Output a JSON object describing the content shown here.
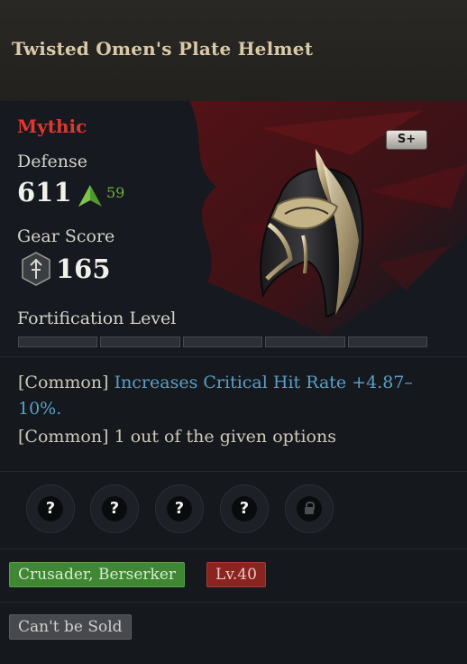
{
  "item": {
    "name": "Twisted Omen's Plate Helmet",
    "rarity": "Mythic",
    "grade_badge": "S+",
    "defense_label": "Defense",
    "defense_value": "611",
    "defense_diff": "59",
    "gear_score_label": "Gear Score",
    "gear_score_value": "165",
    "fortification_label": "Fortification Level",
    "fortification_filled": 0,
    "fortification_total": 5
  },
  "options": [
    {
      "tag": "[Common]",
      "effect": "Increases Critical Hit Rate +4.87–10%."
    },
    {
      "tag": "[Common]",
      "text": "1 out of the given options"
    }
  ],
  "gem_slots": [
    {
      "glyph": "?",
      "locked": false
    },
    {
      "glyph": "?",
      "locked": false
    },
    {
      "glyph": "?",
      "locked": false
    },
    {
      "glyph": "?",
      "locked": false
    },
    {
      "glyph": "",
      "locked": true
    }
  ],
  "tags": {
    "classes": "Crusader, Berserker",
    "level": "Lv.40",
    "sell_status": "Can't be Sold"
  },
  "colors": {
    "rarity": "#e0382f",
    "effect": "#5a9fc8",
    "upgrade": "#6fb13e",
    "class_tag": "#3f8732",
    "level_tag": "#8a2421"
  },
  "icons": {
    "upgrade": "up-arrow-icon",
    "gear_score": "gear-score-shield-icon",
    "lock": "lock-icon"
  }
}
